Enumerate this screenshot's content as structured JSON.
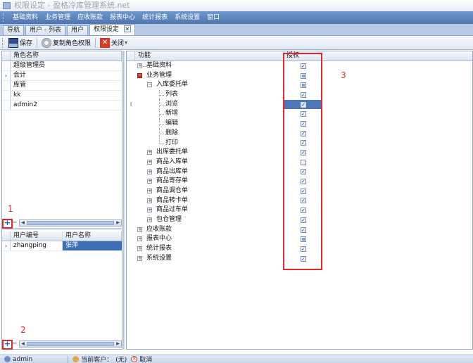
{
  "window": {
    "title": "权限设定 - 盈格冷库管理系统.net"
  },
  "menubar": {
    "items": [
      "基础资料",
      "业务管理",
      "应收账款",
      "报表中心",
      "统计报表",
      "系统设置",
      "窗口"
    ]
  },
  "tabs": [
    {
      "label": "导航",
      "active": false
    },
    {
      "label": "用户 - 列表",
      "active": false
    },
    {
      "label": "用户",
      "active": false
    },
    {
      "label": "权限设定",
      "active": true
    }
  ],
  "toolbar": {
    "save_label": "保存",
    "copy_label": "复制角色权限",
    "close_label": "关闭"
  },
  "roles": {
    "header": "角色名称",
    "rows": [
      "超级管理员",
      "会计",
      "库管",
      "kk",
      "admin2"
    ],
    "selected_index": 1
  },
  "users": {
    "headers": [
      "用户编号",
      "用户名称"
    ],
    "rows": [
      {
        "id": "zhangping",
        "name": "张萍"
      }
    ]
  },
  "tree": {
    "headers": {
      "func": "功能",
      "auth": "授权"
    },
    "rows": [
      {
        "label": "基础资料",
        "check": "checked"
      },
      {
        "label": "业务管理",
        "check": "partial"
      },
      {
        "label": "入库委托单",
        "check": "partial"
      },
      {
        "label": "列表",
        "check": "checked"
      },
      {
        "label": "浏览",
        "check": "checked"
      },
      {
        "label": "新增",
        "check": "checked"
      },
      {
        "label": "编辑",
        "check": "checked"
      },
      {
        "label": "删除",
        "check": "checked"
      },
      {
        "label": "打印",
        "check": "checked"
      },
      {
        "label": "出库委托单",
        "check": "checked"
      },
      {
        "label": "商品入库单",
        "check": "empty"
      },
      {
        "label": "商品出库单",
        "check": "checked"
      },
      {
        "label": "商品寄存单",
        "check": "checked"
      },
      {
        "label": "商品调仓单",
        "check": "checked"
      },
      {
        "label": "商品转卡单",
        "check": "checked"
      },
      {
        "label": "商品过车单",
        "check": "checked"
      },
      {
        "label": "包仓管理",
        "check": "checked"
      },
      {
        "label": "应收账款",
        "check": "checked"
      },
      {
        "label": "报表中心",
        "check": "partial"
      },
      {
        "label": "统计报表",
        "check": "checked"
      },
      {
        "label": "系统设置",
        "check": "checked"
      }
    ]
  },
  "annotations": [
    "1",
    "2",
    "3"
  ],
  "statusbar": {
    "user": "admin",
    "customer_label": "当前客户：",
    "customer_value": "(无)",
    "cancel_label": "取消"
  },
  "colors": {
    "menubar": "#5a84bf",
    "selection": "#3d6fb6",
    "annotation": "#e1282a"
  }
}
